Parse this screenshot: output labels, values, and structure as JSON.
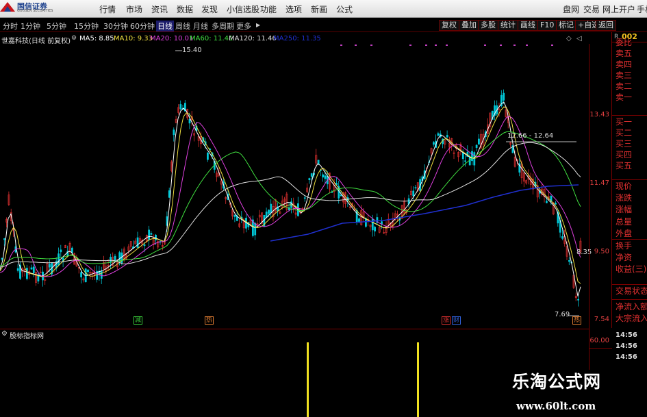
{
  "app": {
    "logo_name": "国信证券",
    "logo_sub": "GUOSEN SECURITIES"
  },
  "top_menu": [
    "行情",
    "市场",
    "资讯",
    "数据",
    "发现",
    "小信选股",
    "功能",
    "选项",
    "新画",
    "公式"
  ],
  "top_right_menu": [
    "盘网",
    "交易",
    "网上开户",
    "手机"
  ],
  "timeframes": [
    "分时",
    "1分钟",
    "5分钟",
    "15分钟",
    "30分钟",
    "60分钟",
    "日线",
    "周线",
    "月线",
    "多周期",
    "更多"
  ],
  "active_timeframe": "日线",
  "toolbar_buttons": [
    "复权",
    "叠加",
    "多股",
    "统计",
    "画线",
    "F10",
    "标记",
    "+自选",
    "返回"
  ],
  "stock_header": {
    "title": "世嘉科技(日线 前复权)",
    "ma5": "MA5: 8.85",
    "ma10": "MA10: 9.33",
    "ma20": "MA20: 10.01",
    "ma60": "MA60: 11.41",
    "ma120": "MA120: 11.46",
    "ma250": "MA250: 11.35"
  },
  "side_code": "002",
  "side_r": "R",
  "price_axis": [
    "13.43",
    "11.47",
    "9.50",
    "7.54"
  ],
  "annotations": {
    "high": "15.40",
    "low": "7.69",
    "range": "12.66 - 12.64",
    "last": "8.35"
  },
  "signal_marks": [
    {
      "text": "减",
      "color": "#38c838"
    },
    {
      "text": "热",
      "color": "#d87830"
    },
    {
      "text": "涨",
      "color": "#d83030"
    },
    {
      "text": "财",
      "color": "#3060d8"
    },
    {
      "text": "热",
      "color": "#d87830"
    }
  ],
  "order_book": [
    "委比",
    "卖五",
    "卖四",
    "卖三",
    "卖二",
    "卖一",
    "买一",
    "买二",
    "买三",
    "买四",
    "买五"
  ],
  "stats": [
    "现价",
    "涨跌",
    "涨幅",
    "总量",
    "外盘",
    "换手",
    "净资",
    "收益(三)"
  ],
  "trade_info": [
    "交易状态",
    "净流入额",
    "大宗流入"
  ],
  "indicator_title": "股标指标网",
  "sub_axis": "60.00",
  "times": [
    "14:56",
    "14:56",
    "14:56"
  ],
  "watermark": {
    "title": "乐淘公式网",
    "url": "www.60lt.com"
  },
  "colors": {
    "up": "#e03030",
    "down": "#00c8d8",
    "ma5": "#ffffff",
    "ma10": "#f0e040",
    "ma20": "#e040e0",
    "ma60": "#40e040",
    "ma120": "#e0e0e0",
    "ma250": "#2030d0",
    "signal": "#f0e020"
  }
}
